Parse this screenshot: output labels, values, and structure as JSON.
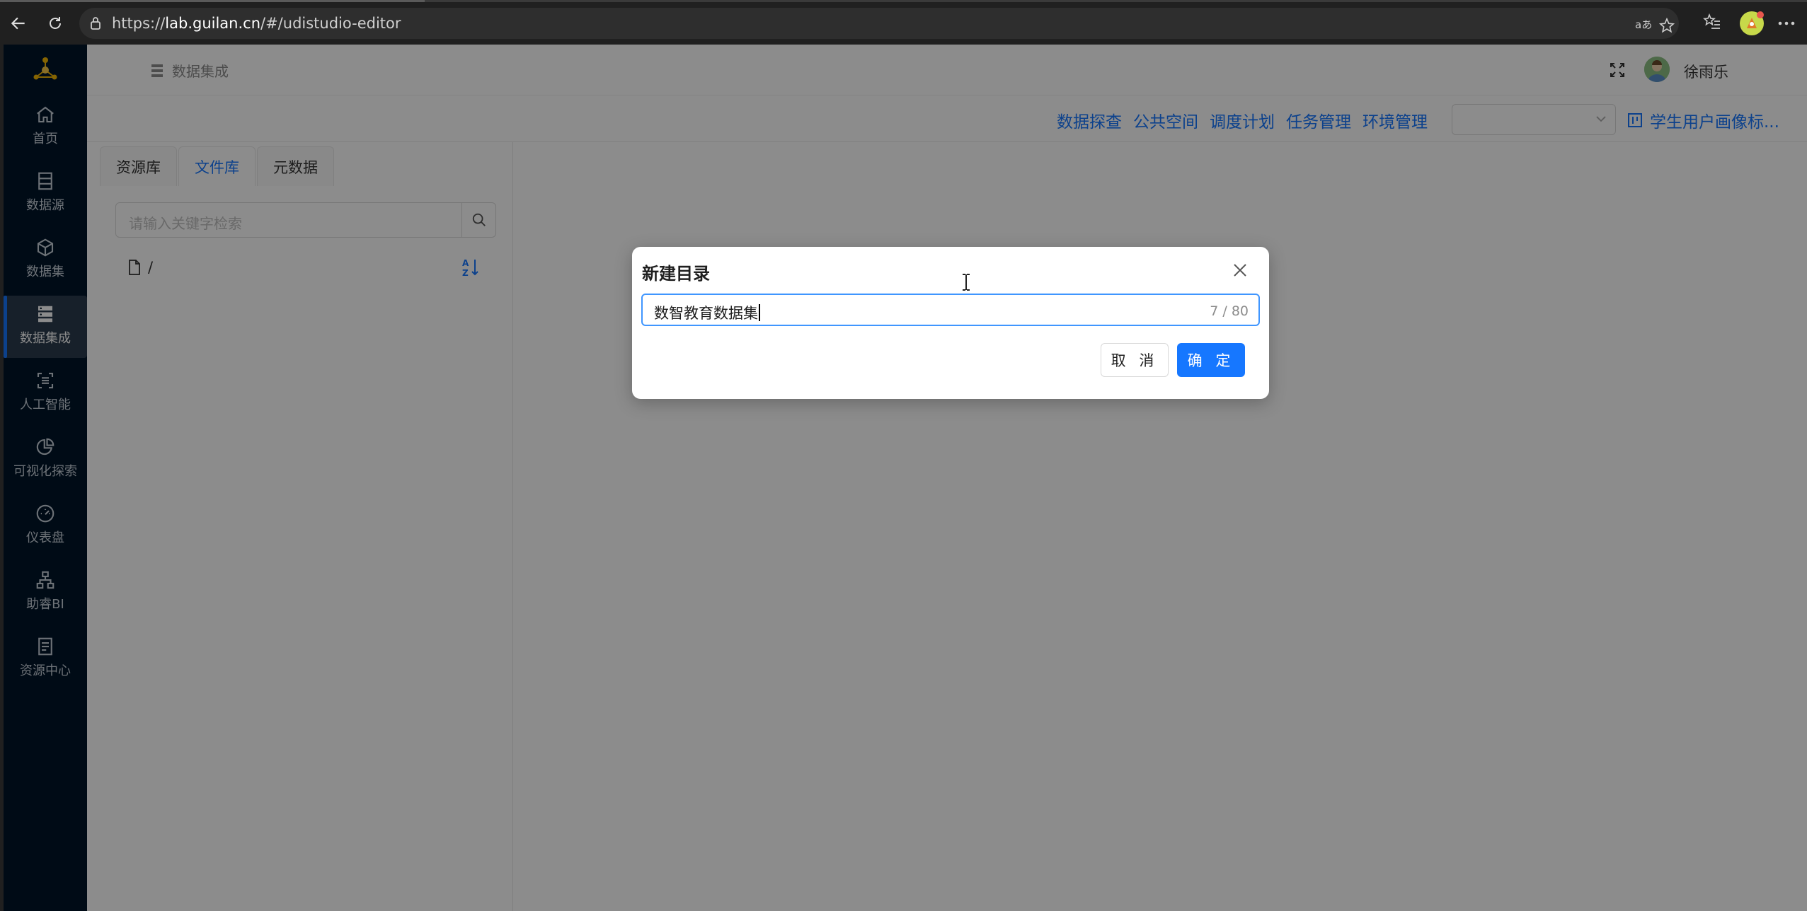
{
  "browser": {
    "url_prefix": "https://",
    "url_host": "lab.guilan.cn",
    "url_path": "/#/udistudio-editor"
  },
  "sidebar": {
    "items": [
      {
        "label": "首页",
        "icon": "home-icon"
      },
      {
        "label": "数据源",
        "icon": "database-icon"
      },
      {
        "label": "数据集",
        "icon": "cube-icon"
      },
      {
        "label": "数据集成",
        "icon": "server-icon",
        "active": true
      },
      {
        "label": "人工智能",
        "icon": "ai-scan-icon"
      },
      {
        "label": "可视化探索",
        "icon": "pie-chart-icon"
      },
      {
        "label": "仪表盘",
        "icon": "gauge-icon"
      },
      {
        "label": "助睿BI",
        "icon": "org-chart-icon"
      },
      {
        "label": "资源中心",
        "icon": "document-icon"
      }
    ]
  },
  "header": {
    "breadcrumb": "数据集成",
    "user_name": "徐雨乐"
  },
  "subbar": {
    "links": [
      "数据探查",
      "公共空间",
      "调度计划",
      "任务管理",
      "环境管理"
    ],
    "select_value": "",
    "project_label": "学生用户画像标..."
  },
  "leftpanel": {
    "tabs": [
      {
        "label": "资源库"
      },
      {
        "label": "文件库",
        "active": true
      },
      {
        "label": "元数据"
      }
    ],
    "search_placeholder": "请输入关键字检索",
    "tree_root": "/"
  },
  "modal": {
    "title": "新建目录",
    "input_value": "数智教育数据集",
    "char_count": "7 / 80",
    "cancel_label": "取 消",
    "ok_label": "确 定"
  },
  "colors": {
    "sidebar_bg": "#001529",
    "primary": "#1677ff"
  }
}
